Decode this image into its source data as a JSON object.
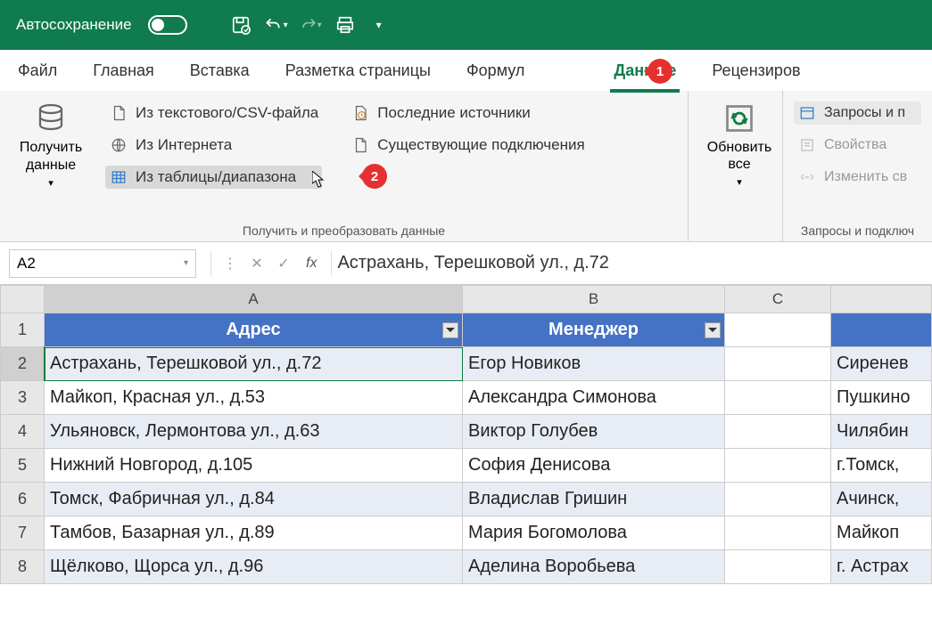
{
  "titlebar": {
    "autosave": "Автосохранение"
  },
  "tabs": {
    "file": "Файл",
    "home": "Главная",
    "insert": "Вставка",
    "pagelayout": "Разметка страницы",
    "formulas": "Формул",
    "data": "Данные",
    "review": "Рецензиров"
  },
  "badges": {
    "one": "1",
    "two": "2"
  },
  "ribbon": {
    "getdata": {
      "big": "Получить\nданные",
      "csv": "Из текстового/CSV-файла",
      "web": "Из Интернета",
      "table": "Из таблицы/диапазона",
      "recent": "Последние источники",
      "existing": "Существующие подключения",
      "group_label": "Получить и преобразовать данные"
    },
    "refresh": {
      "big": "Обновить\nвсе"
    },
    "queries": {
      "q": "Запросы и п",
      "props": "Свойства",
      "edit": "Изменить св",
      "group_label": "Запросы и подключ"
    }
  },
  "formula": {
    "name_box": "A2",
    "value": "Астрахань, Терешковой ул., д.72"
  },
  "columns": [
    "A",
    "B",
    "C",
    ""
  ],
  "table_headers": {
    "address": "Адрес",
    "manager": "Менеджер"
  },
  "rows": [
    {
      "n": "1",
      "a": "",
      "b": "",
      "c": "",
      "d": ""
    },
    {
      "n": "2",
      "a": "Астрахань, Терешковой ул., д.72",
      "b": "Егор Новиков",
      "c": "",
      "d": "Сиренев"
    },
    {
      "n": "3",
      "a": "Майкоп, Красная ул., д.53",
      "b": "Александра Симонова",
      "c": "",
      "d": "Пушкино"
    },
    {
      "n": "4",
      "a": "Ульяновск, Лермонтова ул., д.63",
      "b": "Виктор Голубев",
      "c": "",
      "d": "Чилябин"
    },
    {
      "n": "5",
      "a": "Нижний Новгород, д.105",
      "b": "София Денисова",
      "c": "",
      "d": "г.Томск,"
    },
    {
      "n": "6",
      "a": "Томск, Фабричная ул., д.84",
      "b": "Владислав Гришин",
      "c": "",
      "d": "Ачинск,"
    },
    {
      "n": "7",
      "a": "Тамбов, Базарная ул., д.89",
      "b": "Мария Богомолова",
      "c": "",
      "d": "Майкоп"
    },
    {
      "n": "8",
      "a": "Щёлково, Щорса ул., д.96",
      "b": "Аделина Воробьева",
      "c": "",
      "d": "г. Астрах"
    }
  ]
}
